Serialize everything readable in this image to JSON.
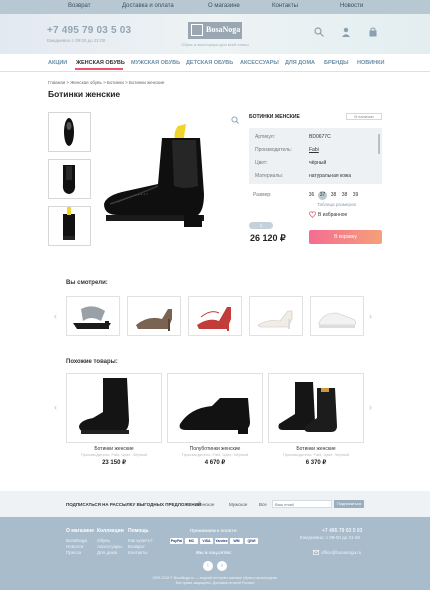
{
  "topnav": [
    "Возврат",
    "Доставка и оплата",
    "О магазине",
    "Контакты",
    "Новости"
  ],
  "header": {
    "phone": "+7 495 79 03 5 03",
    "hours": "Ежедневно с 09:00 до 21:00",
    "logo": "BosaNoga",
    "tagline": "Обувь и аксессуары для всей семьи"
  },
  "categories": [
    "АКЦИИ",
    "ЖЕНСКАЯ ОБУВЬ",
    "МУЖСКАЯ ОБУВЬ",
    "ДЕТСКАЯ ОБУВЬ",
    "АКСЕССУАРЫ",
    "ДЛЯ ДОМА",
    "БРЕНДЫ",
    "НОВИНКИ"
  ],
  "breadcrumbs": "Главная  >  Женская обувь  >  Ботинки  >  Ботинки женские",
  "page_title": "Ботинки женские",
  "product": {
    "name": "БОТИНКИ ЖЕНСКИЕ",
    "in_stock": "В наличии",
    "specs": [
      {
        "label": "Артикул:",
        "value": "BD0677C"
      },
      {
        "label": "Производитель:",
        "value": "Fabi"
      },
      {
        "label": "Цвет:",
        "value": "чёрный"
      },
      {
        "label": "Материалы:",
        "value": "натуральная кожа"
      }
    ],
    "size_label": "Размер:",
    "sizes": [
      "36",
      "37",
      "38",
      "38",
      "39"
    ],
    "selected_size_index": 1,
    "size_table": "Таблица размеров",
    "favorite": "В избранное",
    "quantity": "1",
    "price": "26 120 ₽",
    "cart_button": "В корзину"
  },
  "seen": {
    "title": "Вы смотрели:"
  },
  "similar": {
    "title": "Похожие товары:",
    "items": [
      {
        "name": "Ботинки женские",
        "sub": "Производитель: Fabi, Цвет: Чёрный",
        "price": "23 150 ₽"
      },
      {
        "name": "Полуботинки женские",
        "sub": "Производитель: Fabi, Цвет: Чёрный",
        "price": "4 670 ₽"
      },
      {
        "name": "Ботинки женские",
        "sub": "Производитель: Fabi, Цвет: Чёрный",
        "price": "6 370 ₽"
      }
    ]
  },
  "newsletter": {
    "title": "ПОДПИСАТЬСЯ НА РАССЫЛКУ ВЫГОДНЫХ ПРЕДЛОЖЕНИЙ",
    "options": [
      "Женское",
      "Мужское",
      "Все"
    ],
    "placeholder": "Ваш email",
    "button": "Подписаться"
  },
  "footer": {
    "col1_title": "О магазине",
    "col1": [
      "BosaNoga",
      "Новости",
      "Пресса"
    ],
    "col2_title": "Коллекции",
    "col2": [
      "Обувь",
      "Аксессуары",
      "Для дома"
    ],
    "col3_title": "Помощь",
    "col3": [
      "Как купить?",
      "Возврат",
      "Контакты"
    ],
    "pay_title": "Принимаем к оплате:",
    "pay": [
      "PayPal",
      "MC",
      "VISA",
      "Yandex",
      "WM",
      "QIWI"
    ],
    "social_title": "Мы в соц.сетях:",
    "phone": "+7 495 79 03 5 03",
    "hours": "Ежедневно: с 09-00 до 21-00",
    "email": "office@bosanoga.ru",
    "copyright": "2009-2018 © BosaNoga.ru — модный интернет-магазин обуви и аксессуаров. Все права защищены. Доставка по всей России!"
  },
  "colors": {
    "accent": "#e9556e",
    "nav_blue": "#6a8ea5",
    "footer_bg": "#a9bccb"
  }
}
